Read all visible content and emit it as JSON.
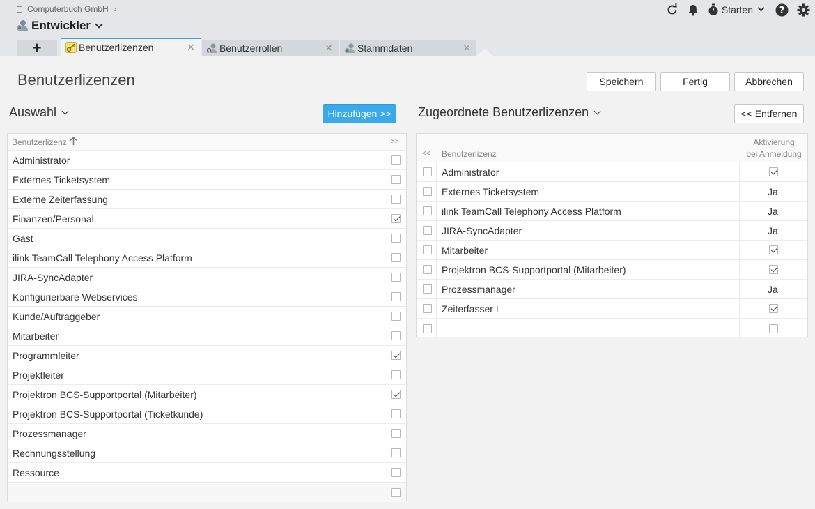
{
  "header": {
    "company": "Computerbuch GmbH",
    "context": "Entwickler",
    "starten_label": "Starten"
  },
  "tabs": [
    {
      "label": "Benutzerlizenzen",
      "active": true
    },
    {
      "label": "Benutzerrollen",
      "active": false
    },
    {
      "label": "Stammdaten",
      "active": false
    }
  ],
  "page": {
    "title": "Benutzerlizenzen",
    "buttons": {
      "save": "Speichern",
      "done": "Fertig",
      "cancel": "Abbrechen"
    }
  },
  "auswahl": {
    "title": "Auswahl",
    "add_button": "Hinzufügen >>",
    "column_header": "Benutzerlizenz",
    "select_all_header": ">>",
    "rows": [
      {
        "name": "Administrator",
        "checked": false
      },
      {
        "name": "Externes Ticketsystem",
        "checked": false
      },
      {
        "name": "Externe Zeiterfassung",
        "checked": false
      },
      {
        "name": "Finanzen/Personal",
        "checked": true
      },
      {
        "name": "Gast",
        "checked": false
      },
      {
        "name": "ilink TeamCall Telephony Access Platform",
        "checked": false
      },
      {
        "name": "JIRA-SyncAdapter",
        "checked": false
      },
      {
        "name": "Konfigurierbare Webservices",
        "checked": false
      },
      {
        "name": "Kunde/Auftraggeber",
        "checked": false
      },
      {
        "name": "Mitarbeiter",
        "checked": false
      },
      {
        "name": "Programmleiter",
        "checked": true
      },
      {
        "name": "Projektleiter",
        "checked": false
      },
      {
        "name": "Projektron BCS-Supportportal (Mitarbeiter)",
        "checked": true
      },
      {
        "name": "Projektron BCS-Supportportal (Ticketkunde)",
        "checked": false
      },
      {
        "name": "Prozessmanager",
        "checked": false
      },
      {
        "name": "Rechnungsstellung",
        "checked": false
      },
      {
        "name": "Ressource",
        "checked": false
      }
    ]
  },
  "zugeordnet": {
    "title": "Zugeordnete Benutzerlizenzen",
    "remove_button": "<< Entfernen",
    "select_all_header": "<<",
    "column_header": "Benutzerlizenz",
    "activation_header_line1": "Aktivierung",
    "activation_header_line2": "bei Anmeldung",
    "rows": [
      {
        "name": "Administrator",
        "activation": "check"
      },
      {
        "name": "Externes Ticketsystem",
        "activation": "Ja"
      },
      {
        "name": "ilink TeamCall Telephony Access Platform",
        "activation": "Ja"
      },
      {
        "name": "JIRA-SyncAdapter",
        "activation": "Ja"
      },
      {
        "name": "Mitarbeiter",
        "activation": "check"
      },
      {
        "name": "Projektron BCS-Supportportal (Mitarbeiter)",
        "activation": "check"
      },
      {
        "name": "Prozessmanager",
        "activation": "Ja"
      },
      {
        "name": "Zeiterfasser I",
        "activation": "check"
      }
    ]
  },
  "icons": [
    "refresh-icon",
    "bell-icon",
    "stopwatch-icon",
    "help-icon",
    "settings-gear-icon",
    "plus-icon",
    "key-icon",
    "user-role-icon",
    "master-data-icon",
    "close-icon",
    "sort-ascending-icon",
    "chevron-down-icon"
  ],
  "colors": {
    "accent": "#3aa9ec",
    "header_bg": "#e4e6ea",
    "tab_bg": "#d4d7dc"
  }
}
